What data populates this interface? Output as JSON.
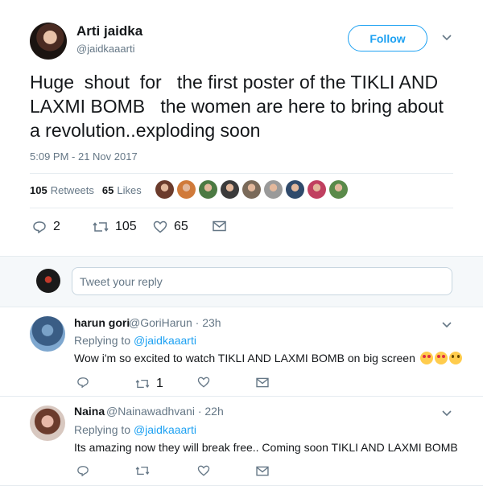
{
  "tweet": {
    "display_name": "Arti jaidka",
    "username": "@jaidkaaarti",
    "follow_label": "Follow",
    "text": "Huge  shout  for   the first poster of the TIKLI AND LAXMI BOMB   the women are here to bring about a revolution..exploding soon",
    "timestamp": "5:09 PM - 21 Nov 2017",
    "retweets_count": "105",
    "retweets_label": "Retweets",
    "likes_count": "65",
    "likes_label": "Likes",
    "liker_colors": [
      "#6b3b2c",
      "#d07a3a",
      "#4c7a43",
      "#3b3b3b",
      "#7a6a5a",
      "#9a9a9a",
      "#2f4a6b",
      "#c04060",
      "#5a8a4a"
    ],
    "actions": {
      "reply_count": "2",
      "retweet_count": "105",
      "like_count": "65"
    }
  },
  "reply_box": {
    "placeholder": "Tweet your reply"
  },
  "replies": [
    {
      "name": "harun gori",
      "handle": "@GoriHarun · 23h",
      "replying_prefix": "Replying to",
      "replying_to": "@jaidkaaarti",
      "text": "Wow i'm so excited to watch TIKLI AND LAXMI BOMB on big screen",
      "emojis": [
        "heart-eyes",
        "heart-eyes",
        "smile"
      ],
      "reply_count": "",
      "retweet_count": "1",
      "like_count": ""
    },
    {
      "name": "Naina",
      "handle": "@Nainawadhvani · 22h",
      "replying_prefix": "Replying to",
      "replying_to": "@jaidkaaarti",
      "text": "Its amazing now they will break free.. Coming soon TIKLI AND LAXMI BOMB",
      "emojis": [],
      "reply_count": "",
      "retweet_count": "",
      "like_count": ""
    }
  ],
  "colors": {
    "accent": "#1da1f2",
    "text": "#14171a",
    "muted": "#657786",
    "border": "#e6ecf0"
  },
  "icons": [
    "reply-icon",
    "retweet-icon",
    "heart-icon",
    "envelope-icon",
    "chevron-down-icon"
  ]
}
